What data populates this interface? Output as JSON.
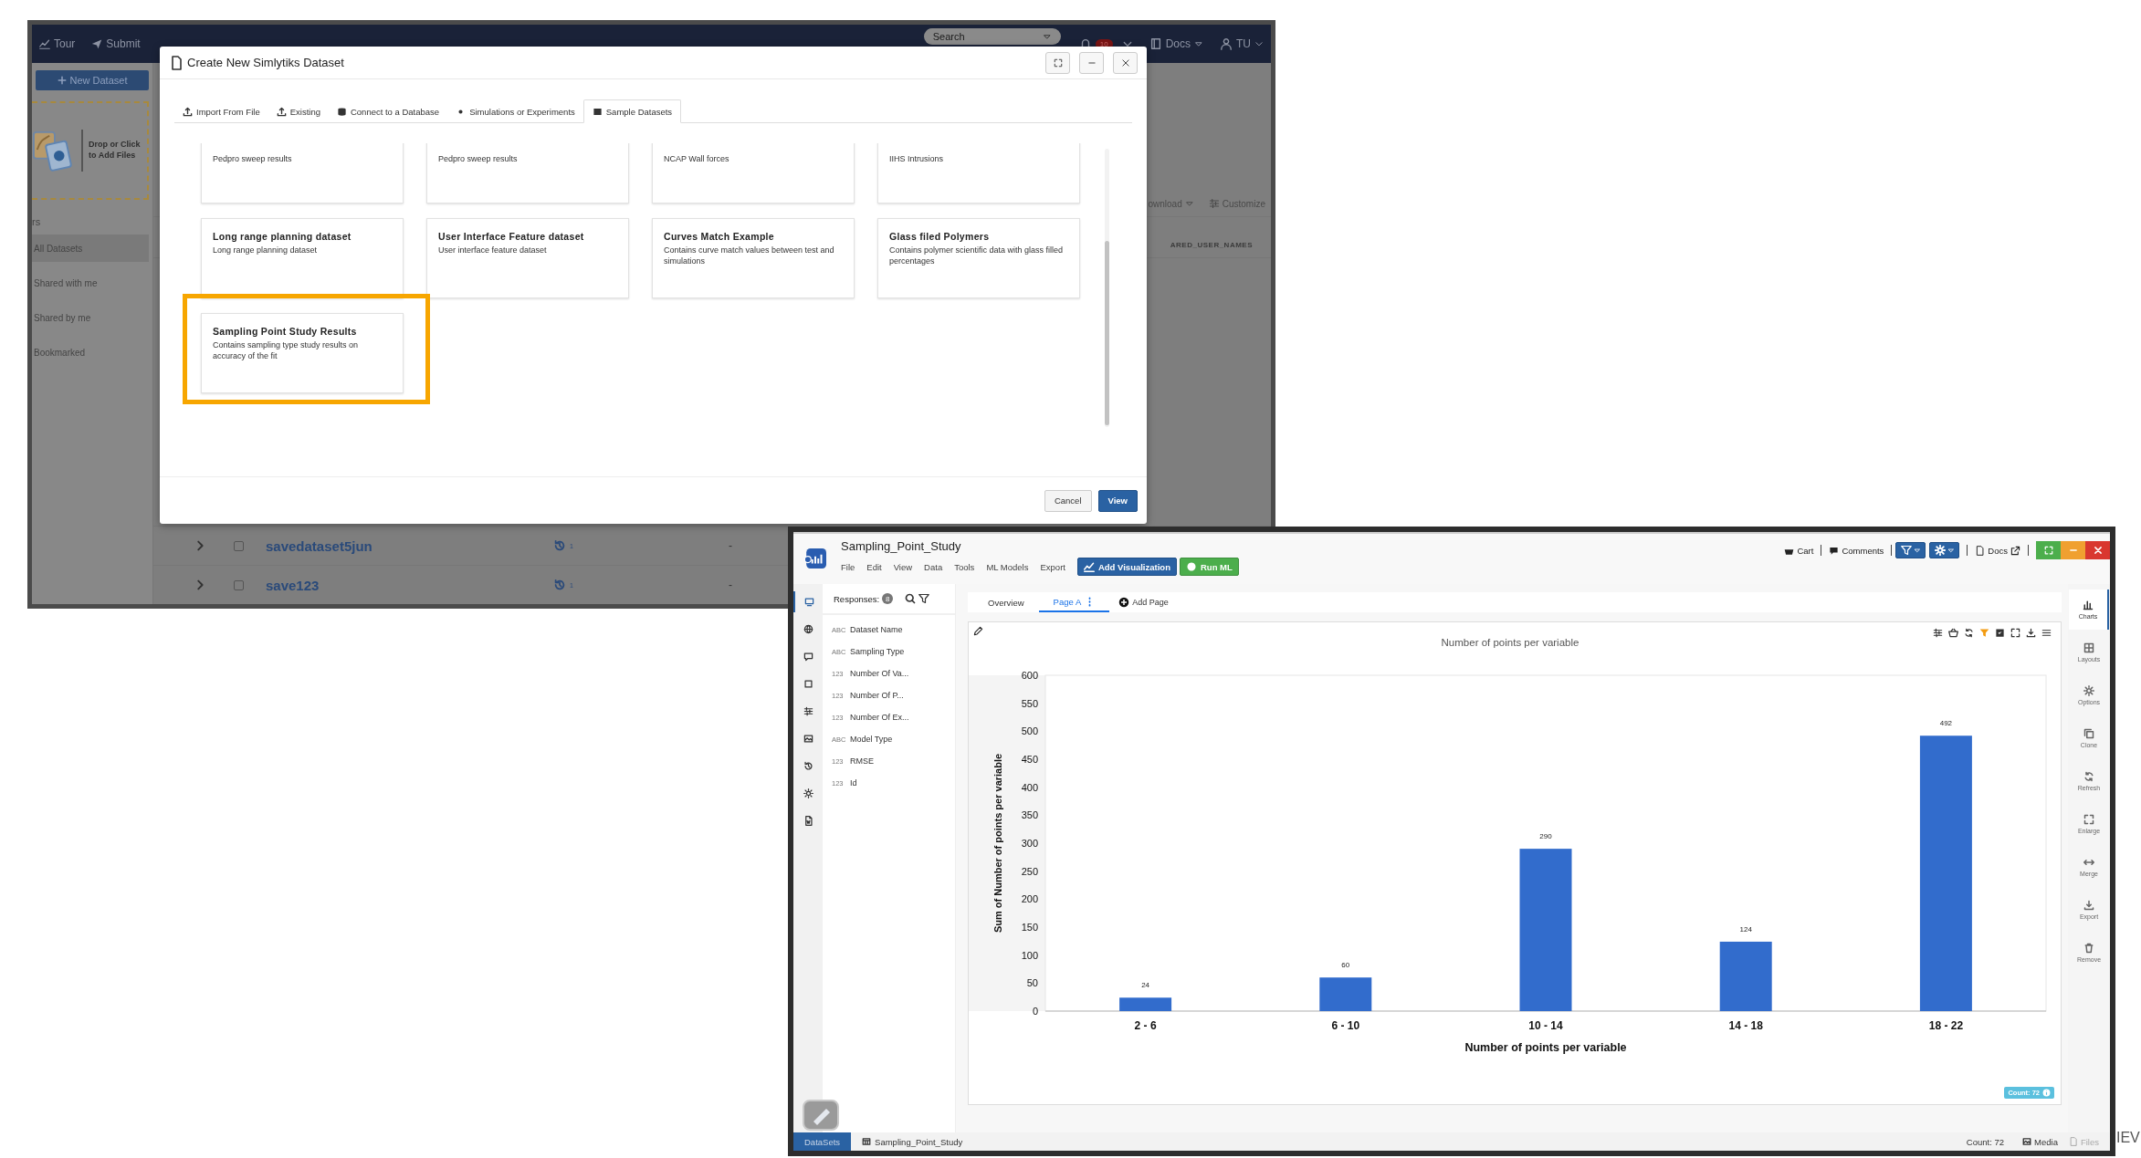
{
  "back_window": {
    "navbar": {
      "links": [
        {
          "label": "Tour"
        },
        {
          "label": "Submit"
        }
      ],
      "search": {
        "placeholder": "Search"
      },
      "notification_count": "10",
      "docs_label": "Docs",
      "user_label": "TU"
    },
    "sidebar": {
      "new_dataset_button": "New Dataset",
      "drop_zone": "Drop or Click to Add Files",
      "section_label": "rs",
      "items": [
        {
          "label": "All Datasets",
          "selected": true
        },
        {
          "label": "Shared with me",
          "selected": false
        },
        {
          "label": "Shared by me",
          "selected": false
        },
        {
          "label": "Bookmarked",
          "selected": false
        }
      ]
    },
    "toolbar": {
      "download_label": "ownload",
      "customize_label": "Customize"
    },
    "table": {
      "column_header": "ARED_USER_NAMES",
      "rows": [
        {
          "name": "savedataset5jun",
          "checked": false,
          "version_count": "1",
          "value": "-"
        },
        {
          "name": "save123",
          "checked": false,
          "version_count": "1",
          "value": "-"
        }
      ]
    },
    "dialog": {
      "title": "Create New Simlytiks Dataset",
      "tabs": [
        {
          "label": "Import From File",
          "selected": false
        },
        {
          "label": "Existing",
          "selected": false
        },
        {
          "label": "Connect to a Database",
          "selected": false
        },
        {
          "label": "Simulations or Experiments",
          "selected": false
        },
        {
          "label": "Sample Datasets",
          "selected": true
        }
      ],
      "cards": [
        {
          "description": "Pedpro sweep results",
          "highlighted": false
        },
        {
          "description": "Pedpro sweep results",
          "highlighted": false
        },
        {
          "description": "NCAP Wall forces",
          "highlighted": false
        },
        {
          "description": "IIHS Intrusions",
          "highlighted": false
        },
        {
          "title": "Long range planning dataset",
          "description": "Long range planning dataset",
          "highlighted": false
        },
        {
          "title": "User Interface Feature dataset",
          "description": "User interface feature dataset",
          "highlighted": false
        },
        {
          "title": "Curves Match Example",
          "description": "Contains curve match values between test and simulations",
          "highlighted": false
        },
        {
          "title": "Glass filed Polymers",
          "description": "Contains polymer scientific data with glass filled percentages",
          "highlighted": false
        },
        {
          "title": "Sampling Point Study Results",
          "description": "Contains sampling type study results on accuracy of the fit",
          "highlighted": true
        }
      ],
      "buttons": [
        {
          "label": "Cancel",
          "kind": "default"
        },
        {
          "label": "View",
          "kind": "primary"
        }
      ]
    }
  },
  "front_window": {
    "title": "Sampling_Point_Study",
    "menu": [
      {
        "label": "File"
      },
      {
        "label": "Edit"
      },
      {
        "label": "View"
      },
      {
        "label": "Data"
      },
      {
        "label": "Tools"
      },
      {
        "label": "ML Models"
      },
      {
        "label": "Export"
      }
    ],
    "actions": [
      {
        "label": "Add Visualization",
        "kind": "primary"
      },
      {
        "label": "Run ML",
        "kind": "success"
      }
    ],
    "header_links": [
      {
        "label": "Cart"
      },
      {
        "label": "Comments"
      },
      {
        "label": "Docs"
      }
    ],
    "rail": [
      {
        "selected": true
      },
      {
        "selected": false
      },
      {
        "selected": false
      },
      {
        "selected": false
      },
      {
        "selected": false
      },
      {
        "selected": false
      },
      {
        "selected": false
      },
      {
        "selected": false
      },
      {
        "selected": false
      }
    ],
    "responses": {
      "label": "Responses:",
      "count": "8",
      "fields": [
        {
          "type_label": "ABC",
          "name": "Dataset Name"
        },
        {
          "type_label": "ABC",
          "name": "Sampling Type"
        },
        {
          "type_label": "123",
          "name": "Number Of Va..."
        },
        {
          "type_label": "123",
          "name": "Number Of P..."
        },
        {
          "type_label": "123",
          "name": "Number Of Ex..."
        },
        {
          "type_label": "ABC",
          "name": "Model Type"
        },
        {
          "type_label": "123",
          "name": "RMSE"
        },
        {
          "type_label": "123",
          "name": "Id"
        }
      ]
    },
    "page_tabs": [
      {
        "label": "Overview",
        "selected": false
      },
      {
        "label": "Page A",
        "selected": true
      }
    ],
    "add_page_label": "Add Page",
    "chart": {
      "count_badge": "Count: 72",
      "chart_data": {
        "type": "bar",
        "title": "Number of points per variable",
        "xlabel": "Number of points per variable",
        "ylabel": "Sum of Number of points per variable",
        "categories": [
          "2 - 6",
          "6 - 10",
          "10 - 14",
          "14 - 18",
          "18 - 22"
        ],
        "series": [
          {
            "color": "#326ccc",
            "values": [
              24,
              60,
              290,
              124,
              492
            ]
          }
        ],
        "ylim": [
          0,
          600
        ],
        "yticks": [
          0,
          50,
          100,
          150,
          200,
          250,
          300,
          350,
          400,
          450,
          500,
          550,
          600
        ],
        "data_labels": true
      }
    },
    "side_tools": [
      {
        "label": "Charts",
        "selected": true
      },
      {
        "label": "Layouts",
        "selected": false
      },
      {
        "label": "Options",
        "selected": false
      },
      {
        "label": "Clone",
        "selected": false
      },
      {
        "label": "Refresh",
        "selected": false
      },
      {
        "label": "Enlarge",
        "selected": false
      },
      {
        "label": "Merge",
        "selected": false
      },
      {
        "label": "Export",
        "selected": false
      },
      {
        "label": "Remove",
        "selected": false
      }
    ],
    "bottom_bar": {
      "tabs": [
        {
          "label": "DataSets",
          "selected": true
        },
        {
          "label": "Sampling_Point_Study",
          "selected": false
        }
      ],
      "count": "Count: 72",
      "media_label": "Media",
      "files_label": "Files"
    }
  },
  "edge_text": "IEV"
}
